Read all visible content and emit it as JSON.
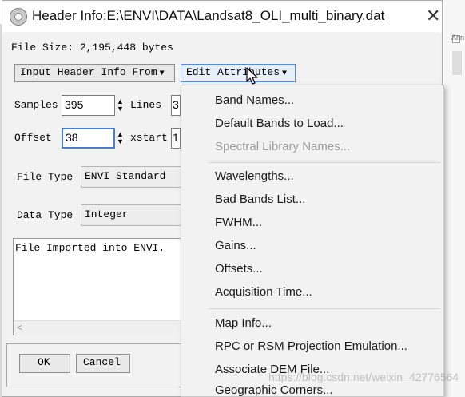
{
  "window": {
    "title": "Header Info:E:\\ENVI\\DATA\\Landsat8_OLI_multi_binary.dat",
    "close_glyph": "✕"
  },
  "file_size": "File Size: 2,195,448 bytes",
  "buttons": {
    "input_header": "Input Header Info From",
    "edit_attributes": "Edit Attributes",
    "ok": "OK",
    "cancel": "Cancel"
  },
  "fields": {
    "samples_label": "Samples",
    "samples_value": "395",
    "lines_label": "Lines",
    "lines_value": "3",
    "offset_label": "Offset",
    "offset_value": "38",
    "xstart_label": "xstart",
    "xstart_value": "1",
    "file_type_label": "File Type",
    "file_type_value": "ENVI Standard",
    "data_type_label": "Data Type",
    "data_type_value": "Integer"
  },
  "description": "File Imported into ENVI.",
  "menu": {
    "items": [
      {
        "label": "Band Names...",
        "enabled": true
      },
      {
        "label": "Default Bands to Load...",
        "enabled": true
      },
      {
        "label": "Spectral Library Names...",
        "enabled": false
      },
      {
        "label": "Wavelengths...",
        "enabled": true
      },
      {
        "label": "Bad Bands List...",
        "enabled": true
      },
      {
        "label": "FWHM...",
        "enabled": true
      },
      {
        "label": "Gains...",
        "enabled": true
      },
      {
        "label": "Offsets...",
        "enabled": true
      },
      {
        "label": "Acquisition Time...",
        "enabled": true
      },
      {
        "label": "Map Info...",
        "enabled": true
      },
      {
        "label": "RPC or RSM Projection Emulation...",
        "enabled": true
      },
      {
        "label": "Associate DEM File...",
        "enabled": true
      },
      {
        "label": "Geographic Corners...",
        "enabled": true
      }
    ]
  },
  "background": {
    "annotation_fragment": "Ann"
  },
  "watermark": "https://blog.csdn.net/weixin_42776564",
  "icons": {
    "app": "envi-globe-icon",
    "dropdown": "caret-down-icon",
    "spinner": "spinner-arrows-icon",
    "cursor": "mouse-pointer-icon"
  },
  "colors": {
    "focus_border": "#4a7fd0",
    "menu_disabled": "#9b9b9b",
    "edit_attr_hover": "#e6f0fa"
  }
}
